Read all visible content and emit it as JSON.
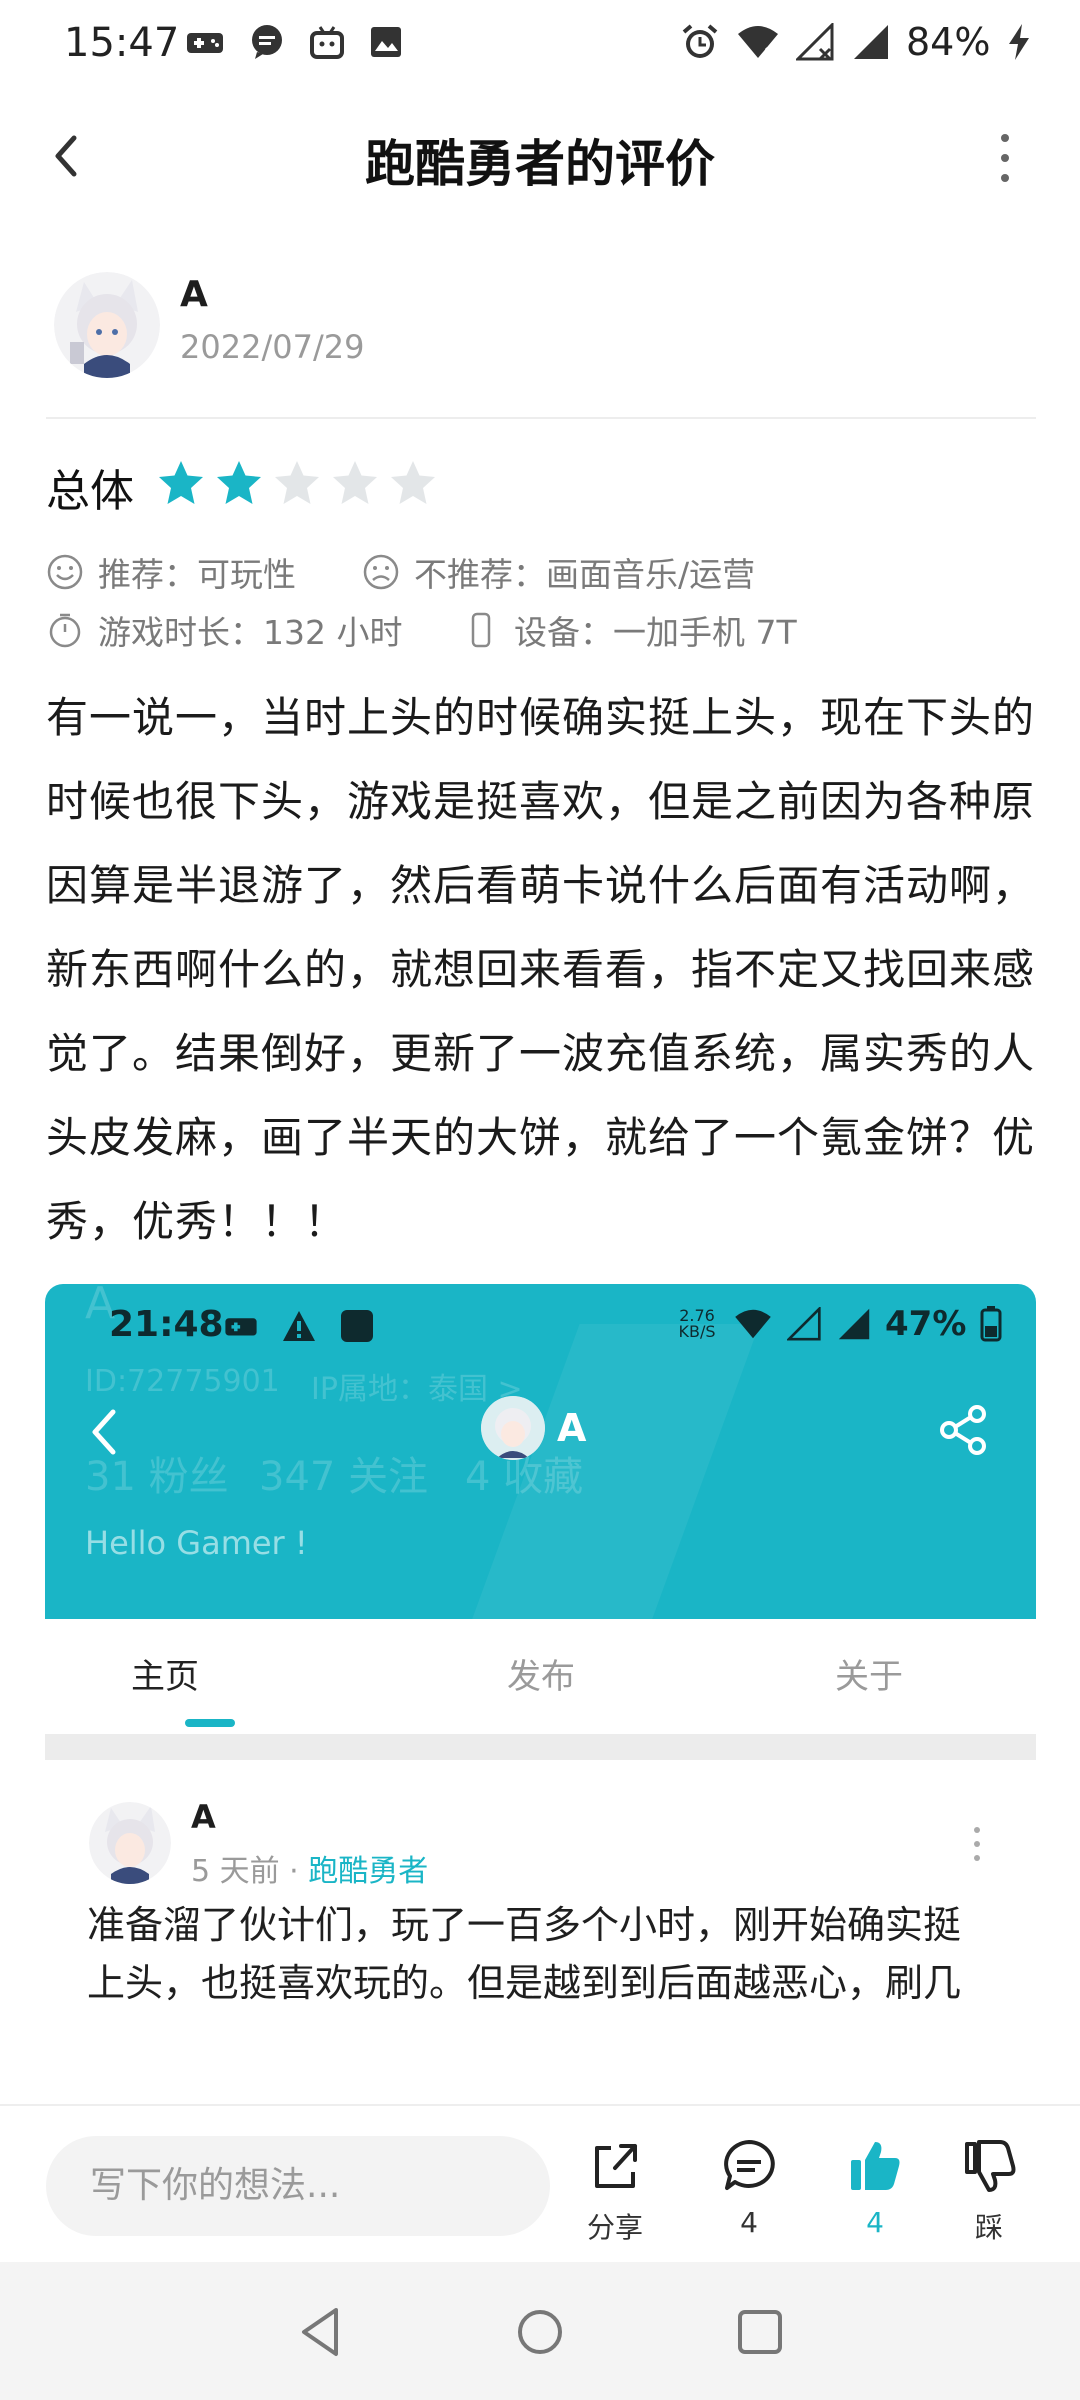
{
  "status_bar": {
    "time": "15:47",
    "battery": "84%",
    "icons": [
      "gamepad-icon",
      "message-icon",
      "bilibili-icon",
      "image-icon",
      "alarm-icon",
      "wifi-icon",
      "signal-off-icon",
      "signal-icon",
      "charging-icon"
    ]
  },
  "header": {
    "title": "跑酷勇者的评价"
  },
  "author": {
    "name": "A",
    "date": "2022/07/29"
  },
  "rating": {
    "label": "总体",
    "stars": 2,
    "max": 5
  },
  "meta": {
    "recommend": "推荐：可玩性",
    "not_recommend": "不推荐：画面音乐/运营",
    "playtime": "游戏时长：132 小时",
    "device": "设备：一加手机 7T"
  },
  "review_text": "有一说一，当时上头的时候确实挺上头，现在下头的时候也很下头，游戏是挺喜欢，但是之前因为各种原因算是半退游了，然后看萌卡说什么后面有活动啊，新东西啊什么的，就想回来看看，指不定又找回来感觉了。结果倒好，更新了一波充值系统，属实秀的人头皮发麻，画了半天的大饼，就给了一个氪金饼？优秀，优秀！！！",
  "screenshot": {
    "time": "21:48",
    "net_speed": "2.76 KB/S",
    "battery": "47%",
    "watermark_id": "ID:72775901",
    "watermark_ip": "IP属地：泰国 >",
    "watermark_fans": "31 粉丝",
    "watermark_follow": "347 关注",
    "watermark_fav": "4 收藏",
    "watermark_hello": "Hello Gamer !",
    "watermark_a": "A",
    "profile_name": "A",
    "tabs": [
      "主页",
      "发布",
      "关于"
    ],
    "active_tab": 0,
    "post": {
      "name": "A",
      "time": "5 天前",
      "sep": "·",
      "game": "跑酷勇者",
      "text": "准备溜了伙计们，玩了一百多个小时，刚开始确实挺上头，也挺喜欢玩的。但是越到到后面越恶心，刷几个小时零提升，装备装备刷不到，宝石宝石合不成，第六三不把握，全15，全全34我得刷全要"
    }
  },
  "action_bar": {
    "placeholder": "写下你的想法...",
    "share_label": "分享",
    "comment_count": "4",
    "like_count": "4",
    "dislike_label": "踩"
  },
  "colors": {
    "accent": "#1ab5c6",
    "star_off": "#e3e6e8"
  }
}
